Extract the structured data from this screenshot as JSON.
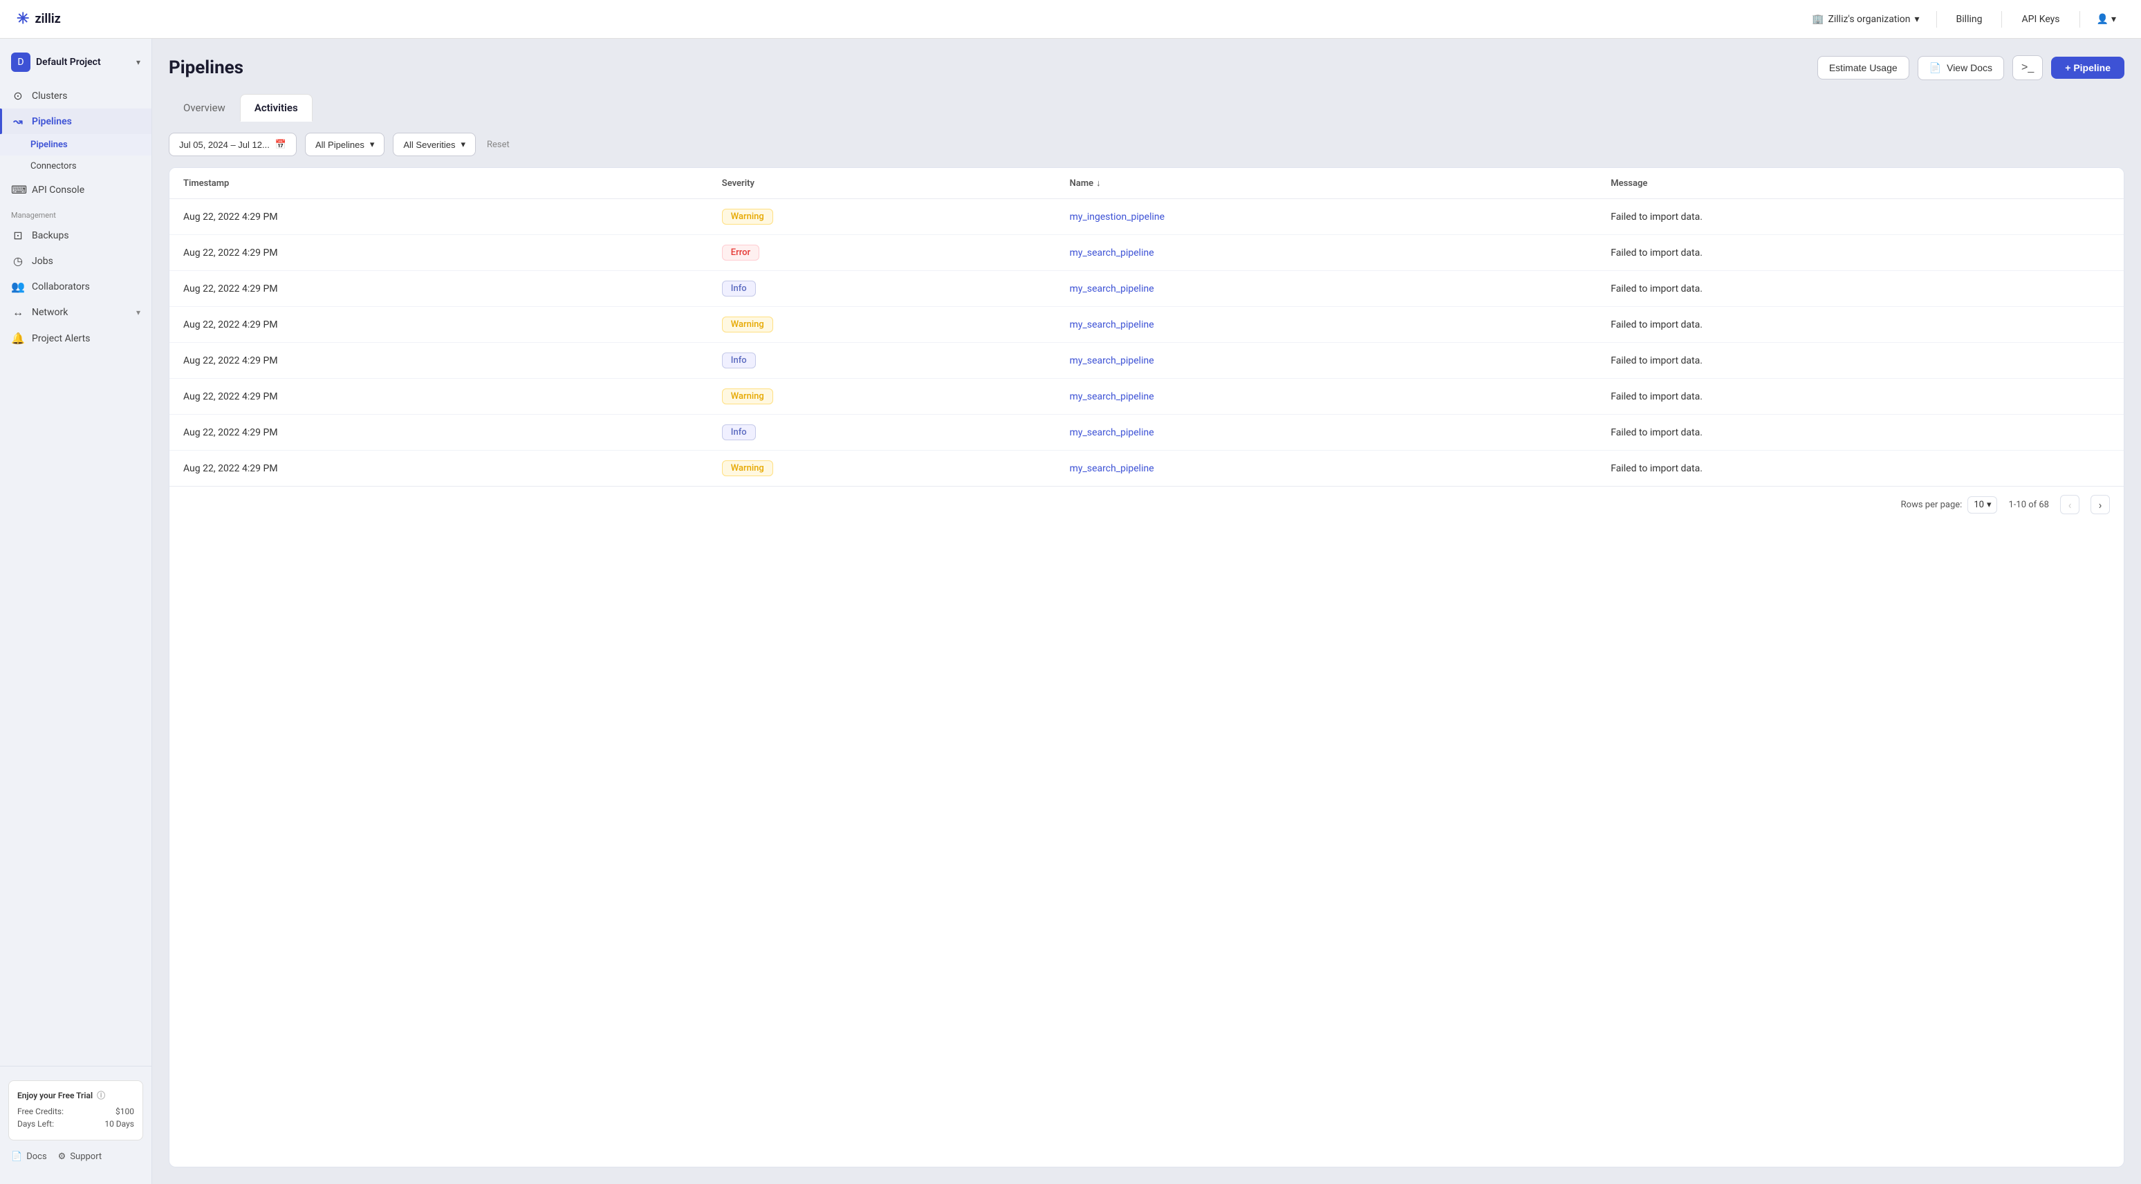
{
  "topNav": {
    "logo": "zilliz",
    "org": "Zilliz's organization",
    "billing": "Billing",
    "apiKeys": "API Keys"
  },
  "sidebar": {
    "project": {
      "name": "Default Project",
      "chevron": "▾"
    },
    "items": [
      {
        "id": "clusters",
        "label": "Clusters",
        "icon": "cluster"
      },
      {
        "id": "pipelines",
        "label": "Pipelines",
        "icon": "pipeline",
        "active": true,
        "expanded": true
      },
      {
        "id": "api-console",
        "label": "API Console",
        "icon": "console"
      }
    ],
    "pipelinesSubItems": [
      {
        "id": "pipelines-sub",
        "label": "Pipelines",
        "active": true
      },
      {
        "id": "connectors",
        "label": "Connectors",
        "active": false
      }
    ],
    "managementLabel": "Management",
    "managementItems": [
      {
        "id": "backups",
        "label": "Backups",
        "icon": "backup"
      },
      {
        "id": "jobs",
        "label": "Jobs",
        "icon": "jobs"
      },
      {
        "id": "collaborators",
        "label": "Collaborators",
        "icon": "collaborators"
      },
      {
        "id": "network",
        "label": "Network",
        "icon": "network",
        "hasChevron": true
      },
      {
        "id": "project-alerts",
        "label": "Project Alerts",
        "icon": "alerts"
      }
    ],
    "trial": {
      "title": "Enjoy your Free Trial",
      "freeCreditsLabel": "Free Credits:",
      "freeCreditsValue": "$100",
      "daysLeftLabel": "Days Left:",
      "daysLeftValue": "10 Days"
    },
    "bottomLinks": [
      {
        "id": "docs",
        "label": "Docs",
        "icon": "docs"
      },
      {
        "id": "support",
        "label": "Support",
        "icon": "support"
      }
    ]
  },
  "page": {
    "title": "Pipelines",
    "estimateUsageBtn": "Estimate Usage",
    "viewDocsBtn": "View Docs",
    "addPipelineBtn": "+ Pipeline"
  },
  "tabs": [
    {
      "id": "overview",
      "label": "Overview",
      "active": false
    },
    {
      "id": "activities",
      "label": "Activities",
      "active": true
    }
  ],
  "filters": {
    "dateRange": "Jul 05, 2024 – Jul 12...",
    "allPipelines": "All Pipelines",
    "allSeverities": "All Severities",
    "reset": "Reset"
  },
  "table": {
    "columns": [
      {
        "id": "timestamp",
        "label": "Timestamp",
        "sortable": false
      },
      {
        "id": "severity",
        "label": "Severity",
        "sortable": false
      },
      {
        "id": "name",
        "label": "Name",
        "sortable": true,
        "sortDir": "asc"
      },
      {
        "id": "message",
        "label": "Message",
        "sortable": false
      }
    ],
    "rows": [
      {
        "id": 1,
        "timestamp": "Aug 22, 2022 4:29 PM",
        "severity": "Warning",
        "severityType": "warning",
        "name": "my_ingestion_pipeline",
        "message": "Failed to import data."
      },
      {
        "id": 2,
        "timestamp": "Aug 22, 2022 4:29 PM",
        "severity": "Error",
        "severityType": "error",
        "name": "my_search_pipeline",
        "message": "Failed to import data."
      },
      {
        "id": 3,
        "timestamp": "Aug 22, 2022 4:29 PM",
        "severity": "Info",
        "severityType": "info",
        "name": "my_search_pipeline",
        "message": "Failed to import data."
      },
      {
        "id": 4,
        "timestamp": "Aug 22, 2022 4:29 PM",
        "severity": "Warning",
        "severityType": "warning",
        "name": "my_search_pipeline",
        "message": "Failed to import data."
      },
      {
        "id": 5,
        "timestamp": "Aug 22, 2022 4:29 PM",
        "severity": "Info",
        "severityType": "info",
        "name": "my_search_pipeline",
        "message": "Failed to import data."
      },
      {
        "id": 6,
        "timestamp": "Aug 22, 2022 4:29 PM",
        "severity": "Warning",
        "severityType": "warning",
        "name": "my_search_pipeline",
        "message": "Failed to import data."
      },
      {
        "id": 7,
        "timestamp": "Aug 22, 2022 4:29 PM",
        "severity": "Info",
        "severityType": "info",
        "name": "my_search_pipeline",
        "message": "Failed to import data."
      },
      {
        "id": 8,
        "timestamp": "Aug 22, 2022 4:29 PM",
        "severity": "Warning",
        "severityType": "warning",
        "name": "my_search_pipeline",
        "message": "Failed to import data."
      }
    ],
    "footer": {
      "rowsPerPageLabel": "Rows per page:",
      "rowsPerPage": "10",
      "paginationInfo": "1-10 of 68"
    }
  }
}
